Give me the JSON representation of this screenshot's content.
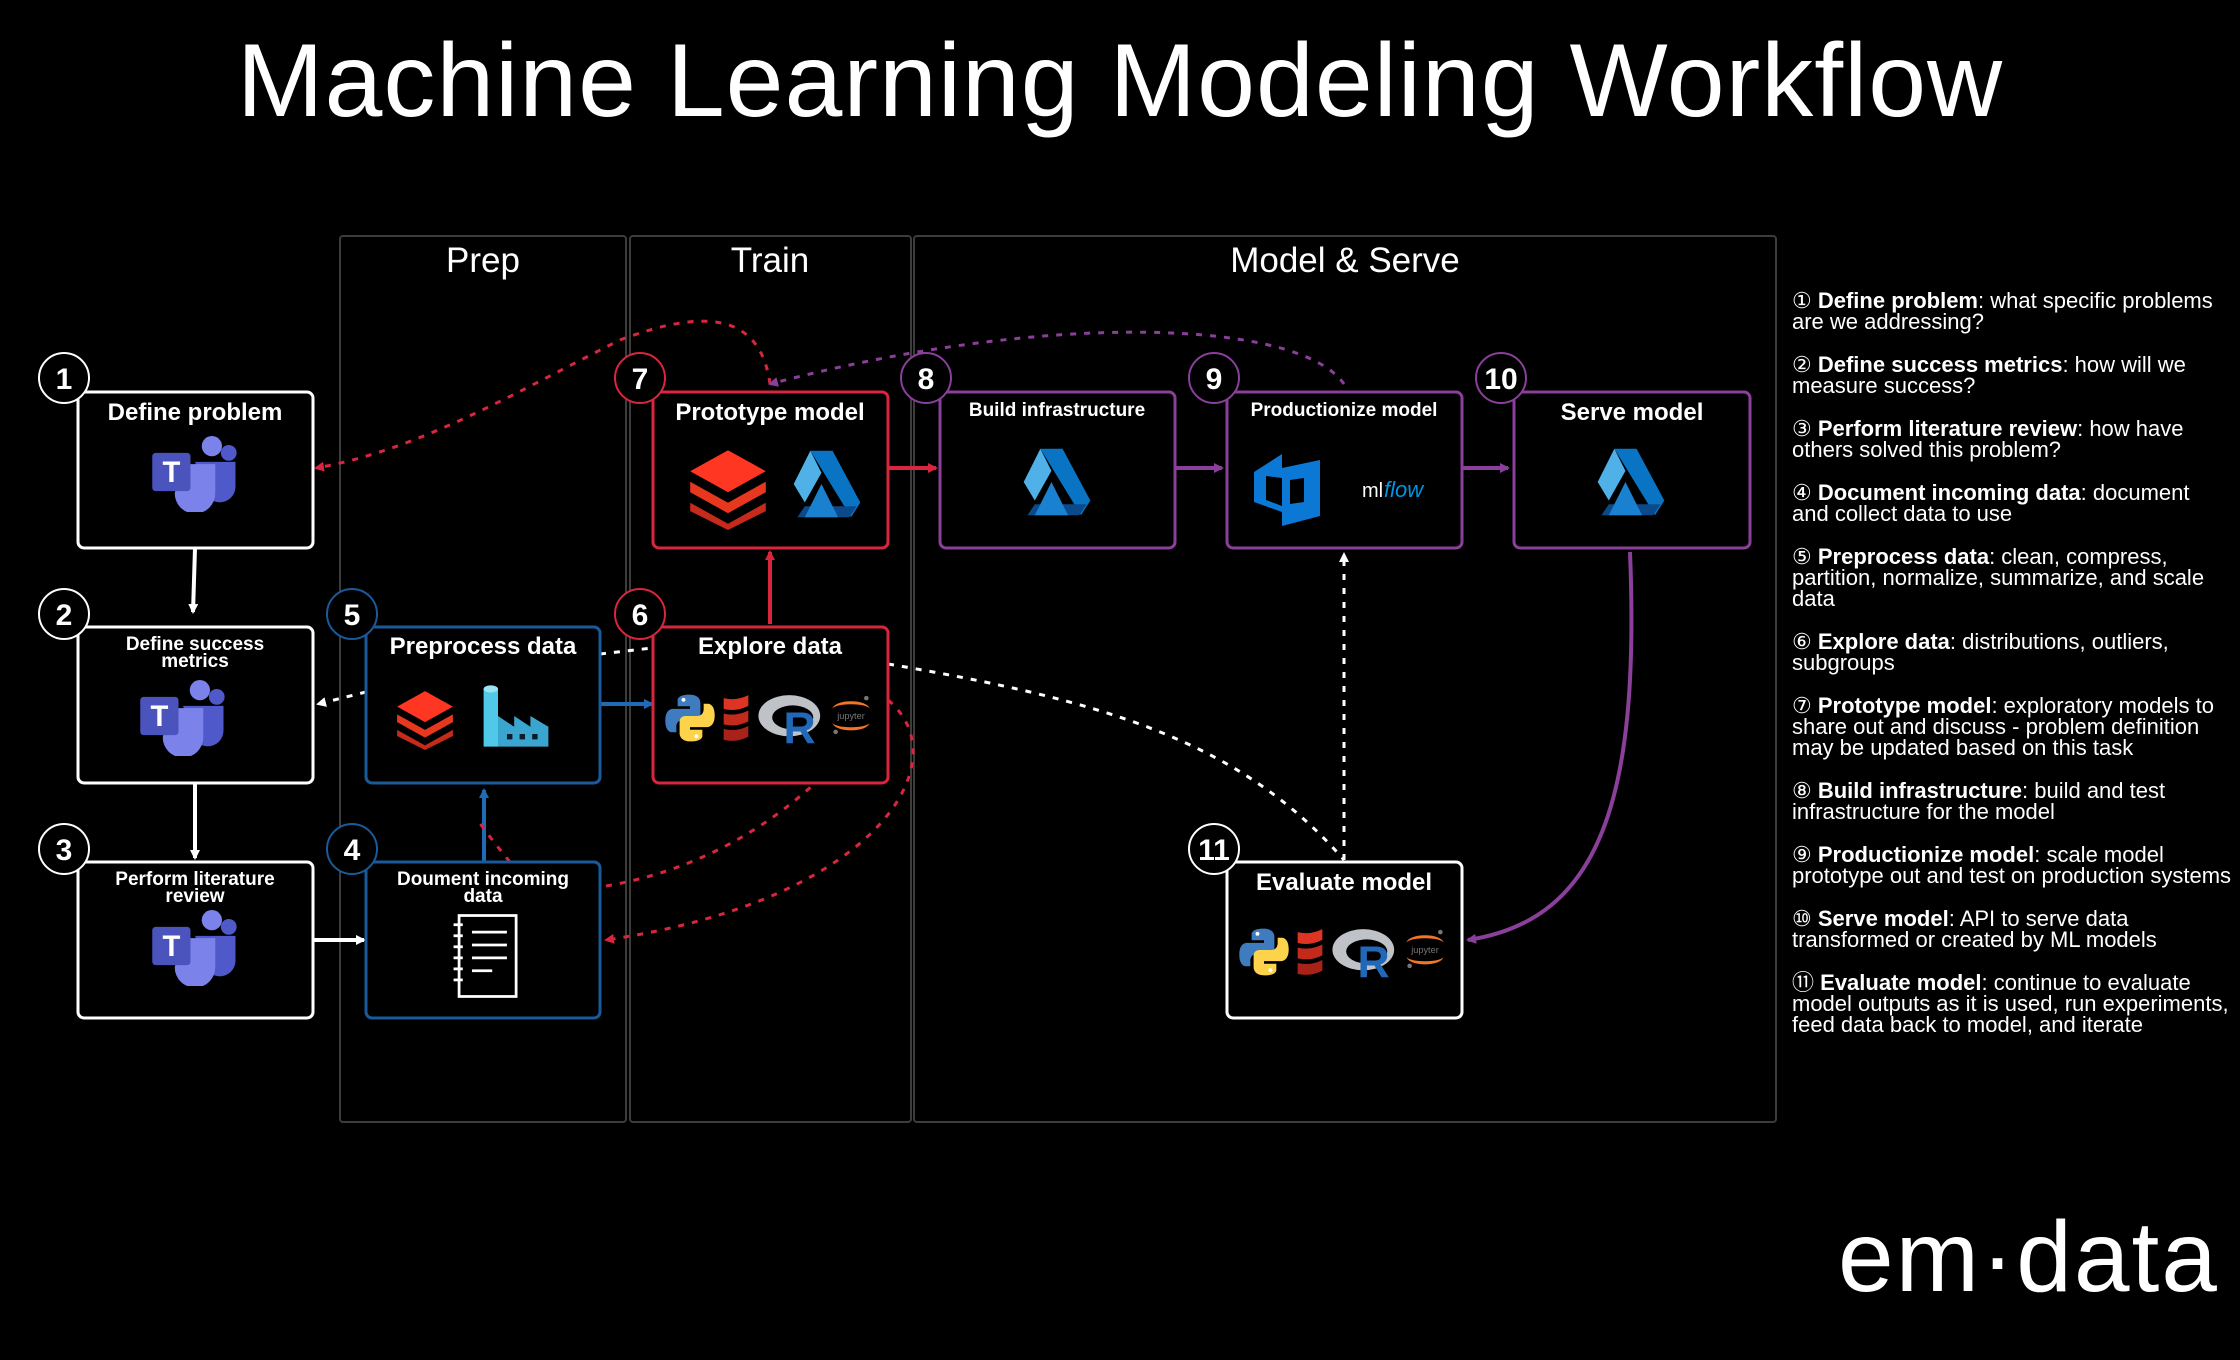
{
  "title": "Machine Learning Modeling Workflow",
  "lanes": {
    "prep": "Prep",
    "train": "Train",
    "model_serve": "Model & Serve"
  },
  "steps": [
    {
      "num": "1",
      "label": "Define problem",
      "icons": [
        "teams-icon"
      ]
    },
    {
      "num": "2",
      "label_lines": [
        "Define success",
        "metrics"
      ],
      "icons": [
        "teams-icon"
      ]
    },
    {
      "num": "3",
      "label_lines": [
        "Perform literature",
        "review"
      ],
      "icons": [
        "teams-icon"
      ]
    },
    {
      "num": "4",
      "label_lines": [
        "Doument incoming",
        "data"
      ],
      "icons": [
        "notebook-icon"
      ]
    },
    {
      "num": "5",
      "label": "Preprocess data",
      "icons": [
        "databricks-icon",
        "data-factory-icon"
      ]
    },
    {
      "num": "6",
      "label": "Explore data",
      "icons": [
        "python-icon",
        "scala-icon",
        "r-icon",
        "jupyter-icon"
      ]
    },
    {
      "num": "7",
      "label": "Prototype model",
      "icons": [
        "databricks-icon",
        "azure-ml-icon"
      ]
    },
    {
      "num": "8",
      "label": "Build infrastructure",
      "icons": [
        "azure-ml-icon"
      ]
    },
    {
      "num": "9",
      "label": "Productionize model",
      "icons": [
        "azure-devops-icon",
        "mlflow-icon"
      ]
    },
    {
      "num": "10",
      "label": "Serve model",
      "icons": [
        "azure-ml-icon"
      ]
    },
    {
      "num": "11",
      "label": "Evaluate model",
      "icons": [
        "python-icon",
        "scala-icon",
        "r-icon",
        "jupyter-icon"
      ]
    }
  ],
  "icon_text": {
    "teams": "T",
    "r": "R",
    "jupyter": "jupyter",
    "mlflow_ml": "ml",
    "mlflow_flow": "flow"
  },
  "colors": {
    "white": "#ffffff",
    "blue": "#1a5a9a",
    "red": "#d7263d",
    "purple": "#8a3f9a",
    "lane_border": "#3c3c3c"
  },
  "sidebar": [
    {
      "marker": "①",
      "term": "Define problem",
      "desc": ": what specific problems are we addressing?"
    },
    {
      "marker": "②",
      "term": "Define success metrics",
      "desc": ": how will we measure success?"
    },
    {
      "marker": "③",
      "term": "Perform literature review",
      "desc": ": how have others solved this problem?"
    },
    {
      "marker": "④",
      "term": "Document incoming data",
      "desc": ": document and collect data to use"
    },
    {
      "marker": "⑤",
      "term": "Preprocess data",
      "desc": ": clean, compress, partition, normalize, summarize, and scale data"
    },
    {
      "marker": "⑥",
      "term": "Explore data",
      "desc": ": distributions, outliers, subgroups"
    },
    {
      "marker": "⑦",
      "term": "Prototype model",
      "desc": ": exploratory models to share out and discuss - problem definition may be updated based on this task"
    },
    {
      "marker": "⑧",
      "term": "Build infrastructure",
      "desc": ": build and test infrastructure for the model"
    },
    {
      "marker": "⑨",
      "term": "Productionize model",
      "desc": ": scale model prototype out and test on production systems"
    },
    {
      "marker": "⑩",
      "term": "Serve model",
      "desc": ": API to serve data transformed or created by ML models"
    },
    {
      "marker": "⑪",
      "term": "Evaluate model",
      "desc": ": continue to evaluate model outputs as it is used, run experiments, feed data back to model, and iterate"
    }
  ],
  "brand": {
    "em": "em",
    "dot": "·",
    "data": "data"
  }
}
